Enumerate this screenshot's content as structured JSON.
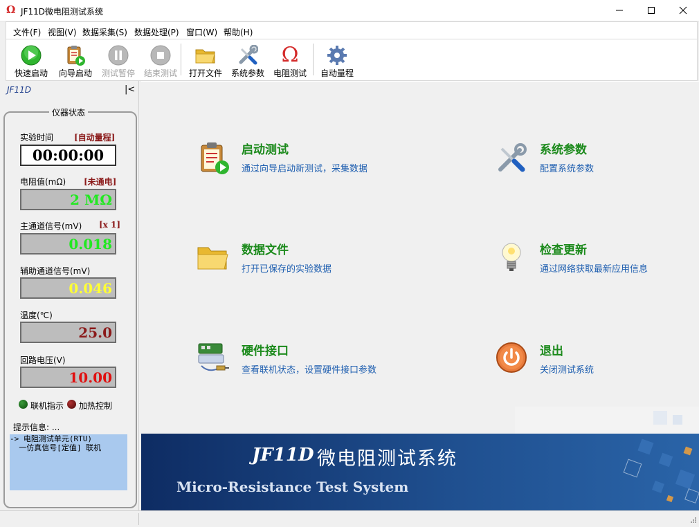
{
  "window": {
    "title": "JF11D微电阻测试系统",
    "app_icon_glyph": "Ω"
  },
  "menu": [
    "文件(F)",
    "视图(V)",
    "数据采集(S)",
    "数据处理(P)",
    "窗口(W)",
    "帮助(H)"
  ],
  "toolbar": {
    "quick_start": "快速启动",
    "wizard_start": "向导启动",
    "pause": "测试暂停",
    "stop": "结束测试",
    "open_file": "打开文件",
    "sys_params": "系统参数",
    "resistance_test": "电阻测试",
    "resistance_glyph": "Ω",
    "auto_range": "自动量程"
  },
  "left_pane": {
    "title": "JF11D",
    "collapse_glyph": "|<",
    "group_title": "仪器状态",
    "time_label": "实验时间",
    "time_tag": "[自动量程]",
    "time_value": "00:00:00",
    "resistance_label": "电阻值(mΩ)",
    "resistance_tag": "[未通电]",
    "resistance_value": "2 MΩ",
    "main_signal_label": "主通道信号(mV)",
    "main_signal_tag": "[x 1]",
    "main_signal_value": "0.018",
    "aux_signal_label": "辅助通道信号(mV)",
    "aux_signal_value": "0.046",
    "temp_label": "温度(℃)",
    "temp_value": "25.0",
    "loop_voltage_label": "回路电压(V)",
    "loop_voltage_value": "10.00",
    "link_indicator_label": "联机指示",
    "heat_control_label": "加热控制",
    "tip_label": "提示信息: ...",
    "log_lines": [
      "-> 电阻测试单元(RTU)",
      "  一仿真信号[定值] 联机"
    ]
  },
  "entries": {
    "start_test": {
      "title": "启动测试",
      "desc": "通过向导启动新测试，采集数据"
    },
    "sys_params": {
      "title": "系统参数",
      "desc": "配置系统参数"
    },
    "data_file": {
      "title": "数据文件",
      "desc": "打开已保存的实验数据"
    },
    "check_update": {
      "title": "检查更新",
      "desc": "通过网络获取最新应用信息"
    },
    "hardware": {
      "title": "硬件接口",
      "desc": "查看联机状态，设置硬件接口参数"
    },
    "exit": {
      "title": "退出",
      "desc": "关闭测试系统"
    }
  },
  "banner": {
    "code": "JF11D",
    "name_cn": "微电阻测试系统",
    "name_en": "Micro-Resistance  Test System"
  },
  "colors": {
    "value_green": "#22e822",
    "value_yellow": "#ffff33",
    "value_darkred": "#8b1a1a",
    "value_red": "#e01010",
    "entry_title": "#1c8a1c",
    "entry_desc": "#1f5fb0",
    "log_bg": "#a9c9ee"
  }
}
